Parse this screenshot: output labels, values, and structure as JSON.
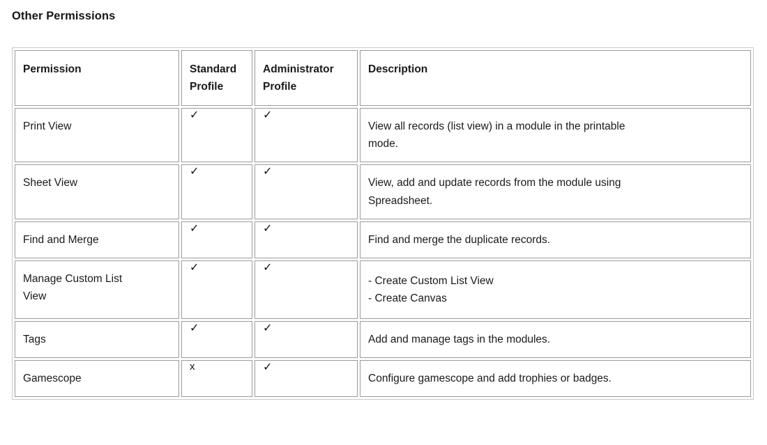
{
  "page": {
    "title": "Other Permissions"
  },
  "table": {
    "headers": {
      "permission": "Permission",
      "standard_profile_line1": "Standard",
      "standard_profile_line2": "Profile",
      "administrator_profile_line1": "Administrator",
      "administrator_profile_line2": "Profile",
      "description": "Description"
    },
    "glyphs": {
      "check": "✓",
      "cross": "x"
    },
    "rows": [
      {
        "permission": "Print View",
        "standard": "✓",
        "administrator": "✓",
        "description_lines": [
          "View all records (list view) in a module in the printable",
          "mode."
        ],
        "description_text": "View all records (list view) in a module in the printable mode."
      },
      {
        "permission": "Sheet View",
        "standard": "✓",
        "administrator": "✓",
        "description_lines": [
          "View, add and update records from the module using",
          "Spreadsheet."
        ],
        "description_text": "View, add and update records from the module using Spreadsheet."
      },
      {
        "permission": "Find and Merge",
        "standard": "✓",
        "administrator": "✓",
        "description_lines": [
          "Find and merge the duplicate records."
        ],
        "description_text": "Find and merge the duplicate records."
      },
      {
        "permission_lines": [
          "Manage Custom List",
          "View"
        ],
        "permission": "Manage Custom List View",
        "standard": "✓",
        "administrator": "✓",
        "description_lines": [
          "- Create Custom List View",
          "- Create Canvas"
        ],
        "description_text": "- Create Custom List View - Create Canvas"
      },
      {
        "permission": "Tags",
        "standard": "✓",
        "administrator": "✓",
        "description_lines": [
          "Add and manage tags in the modules."
        ],
        "description_text": "Add and manage tags in the modules."
      },
      {
        "permission": "Gamescope",
        "standard": "x",
        "administrator": "✓",
        "description_lines": [
          "Configure gamescope and add trophies or badges."
        ],
        "description_text": "Configure gamescope and add trophies or badges."
      }
    ]
  },
  "colors": {
    "text": "#1a1a1a",
    "cell_border": "#9a9a9a",
    "table_outer_border": "#c9c9c9",
    "background": "#ffffff"
  }
}
